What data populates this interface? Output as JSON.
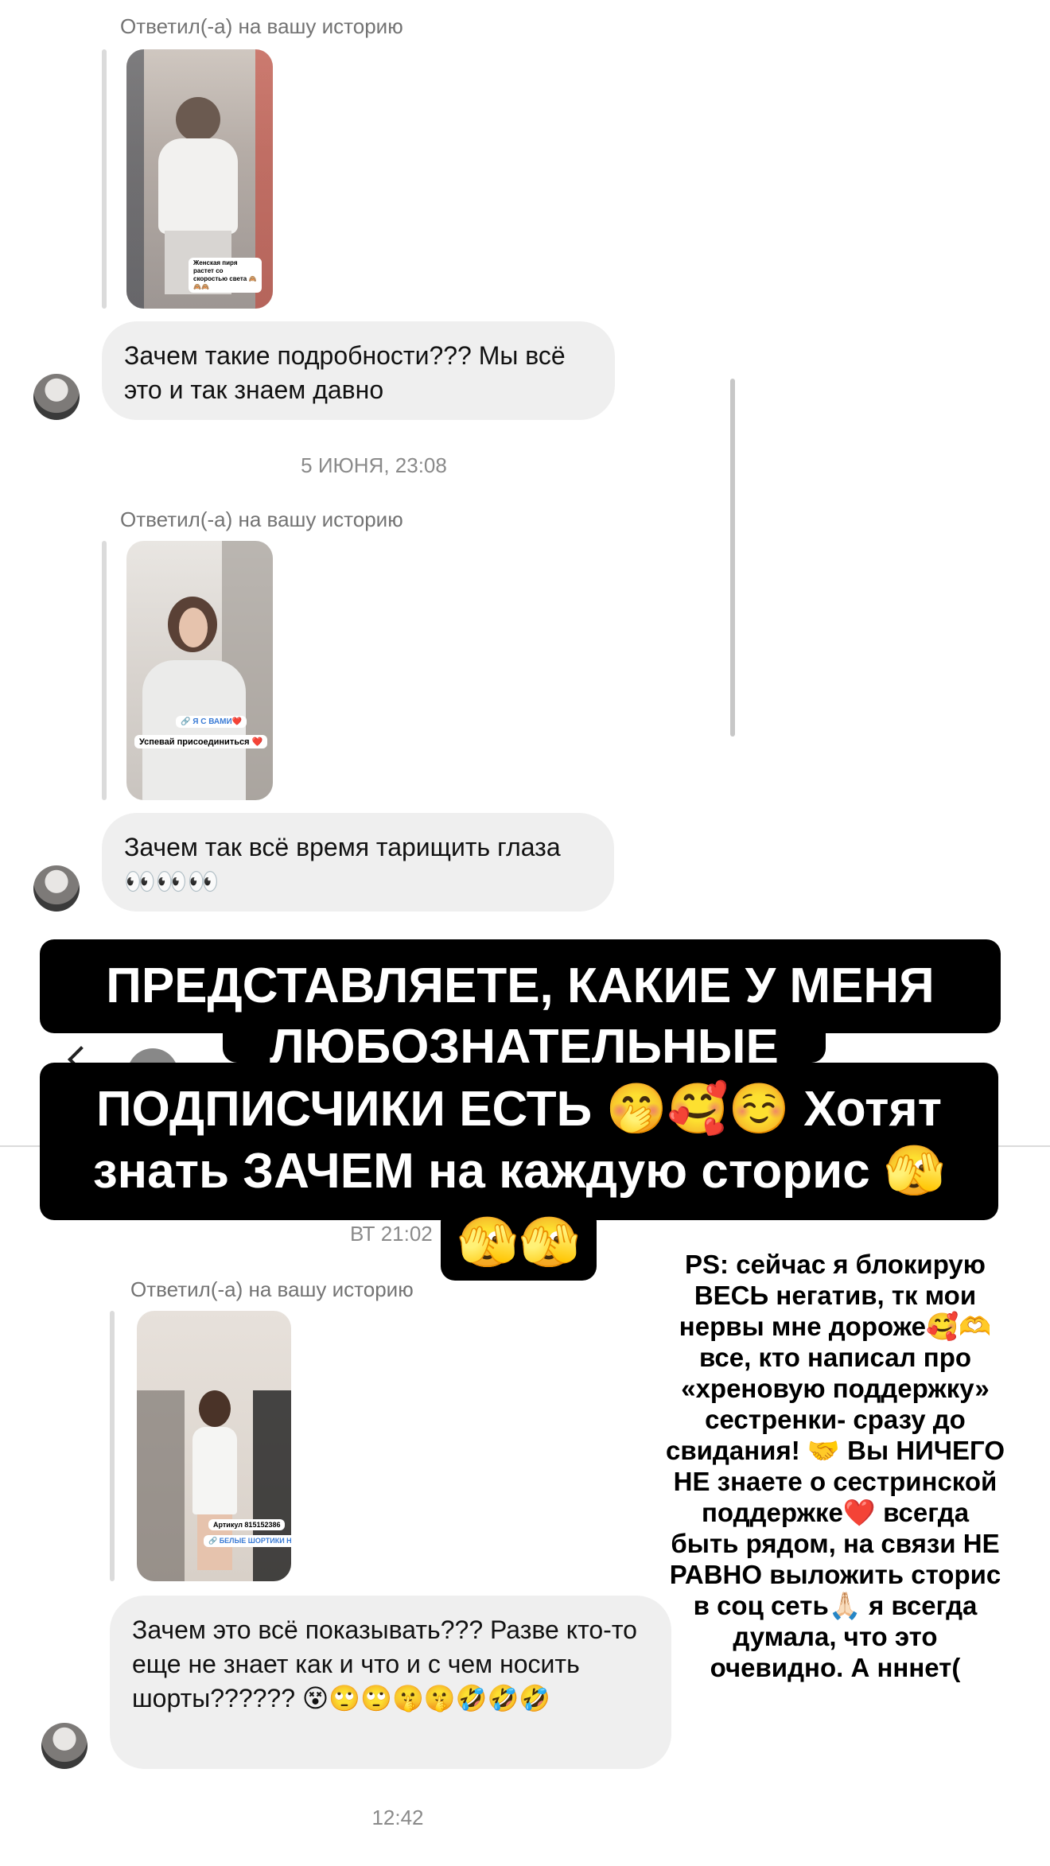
{
  "replied_label": "Ответил(-а) на вашу историю",
  "messages": [
    {
      "text": "Зачем такие подробности??? Мы всё это и так знаем давно",
      "thumb_sticker": "Женская пиря растет со скоростью света 🙈🙈🙈"
    },
    {
      "text": "Зачем так всё время тарищить глаза 👀👀👀",
      "thumb_sticker": "🔗 Я С ВАМИ❤️",
      "thumb_sticker2": "Успевай присоединиться ❤️"
    },
    {
      "text": "Зачем это всё показывать??? Разве кто-то еще не знает как и что и с чем носить шорты?????? 😵🙄🙄🤫🤫🤣🤣🤣",
      "thumb_sticker": "Артикул 815152386",
      "thumb_sticker2": "🔗 БЕЛЫЕ ШОРТИКИ НА WB"
    }
  ],
  "timestamps": {
    "t1": "5 ИЮНЯ, 23:08",
    "t2": "ВТ 21:02",
    "t3": "12:42"
  },
  "caption": {
    "line1": "ПРЕДСТАВЛЯЕТЕ, КАКИЕ У МЕНЯ",
    "line2": "ЛЮБОЗНАТЕЛЬНЫЕ",
    "line3": "ПОДПИСЧИКИ ЕСТЬ 🤭🥰☺️ Хотят",
    "line4": "знать ЗАЧЕМ на каждую сторис 🫣",
    "line5": "🫣🫣"
  },
  "ps_text": "PS: сейчас я блокирую\nВЕСЬ негатив, тк мои\nнервы мне дороже🥰🫶\nвсе, кто написал про\n«хреновую поддержку»\nсестренки- сразу до\nсвидания! 🤝 Вы НИЧЕГО\nНЕ знаете о сестринской\nподдержке❤️ всегда\nбыть рядом, на связи НЕ\nРАВНО выложить сторис\nв соц сеть🙏🏻 я всегда\nдумала, что это\nочевидно. А нннет(",
  "colors": {
    "bubble_bg": "#efefef",
    "caption_bg": "#000000",
    "caption_text": "#ffffff",
    "meta_text": "#737373"
  }
}
